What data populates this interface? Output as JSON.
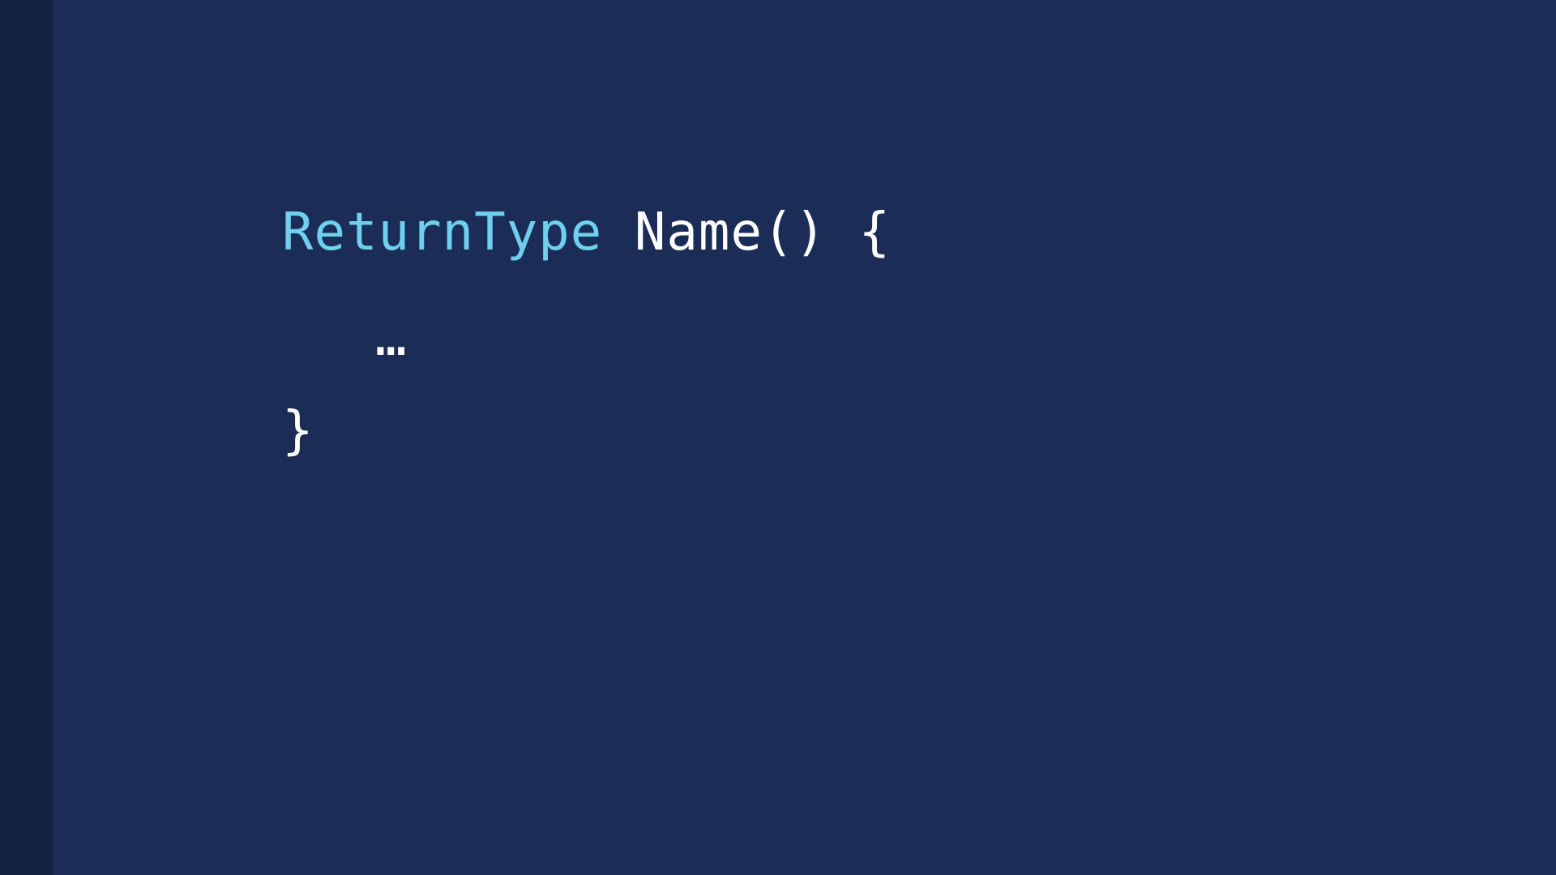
{
  "code": {
    "line1": {
      "return_type": "ReturnType",
      "name_and_params": "Name()",
      "open_brace": "{"
    },
    "line2": {
      "body": "…"
    },
    "line3": {
      "close_brace": "}"
    }
  },
  "colors": {
    "background": "#1b2d57",
    "gutter": "#132342",
    "keyword_type": "#6fd0ee",
    "text": "#ffffff"
  }
}
